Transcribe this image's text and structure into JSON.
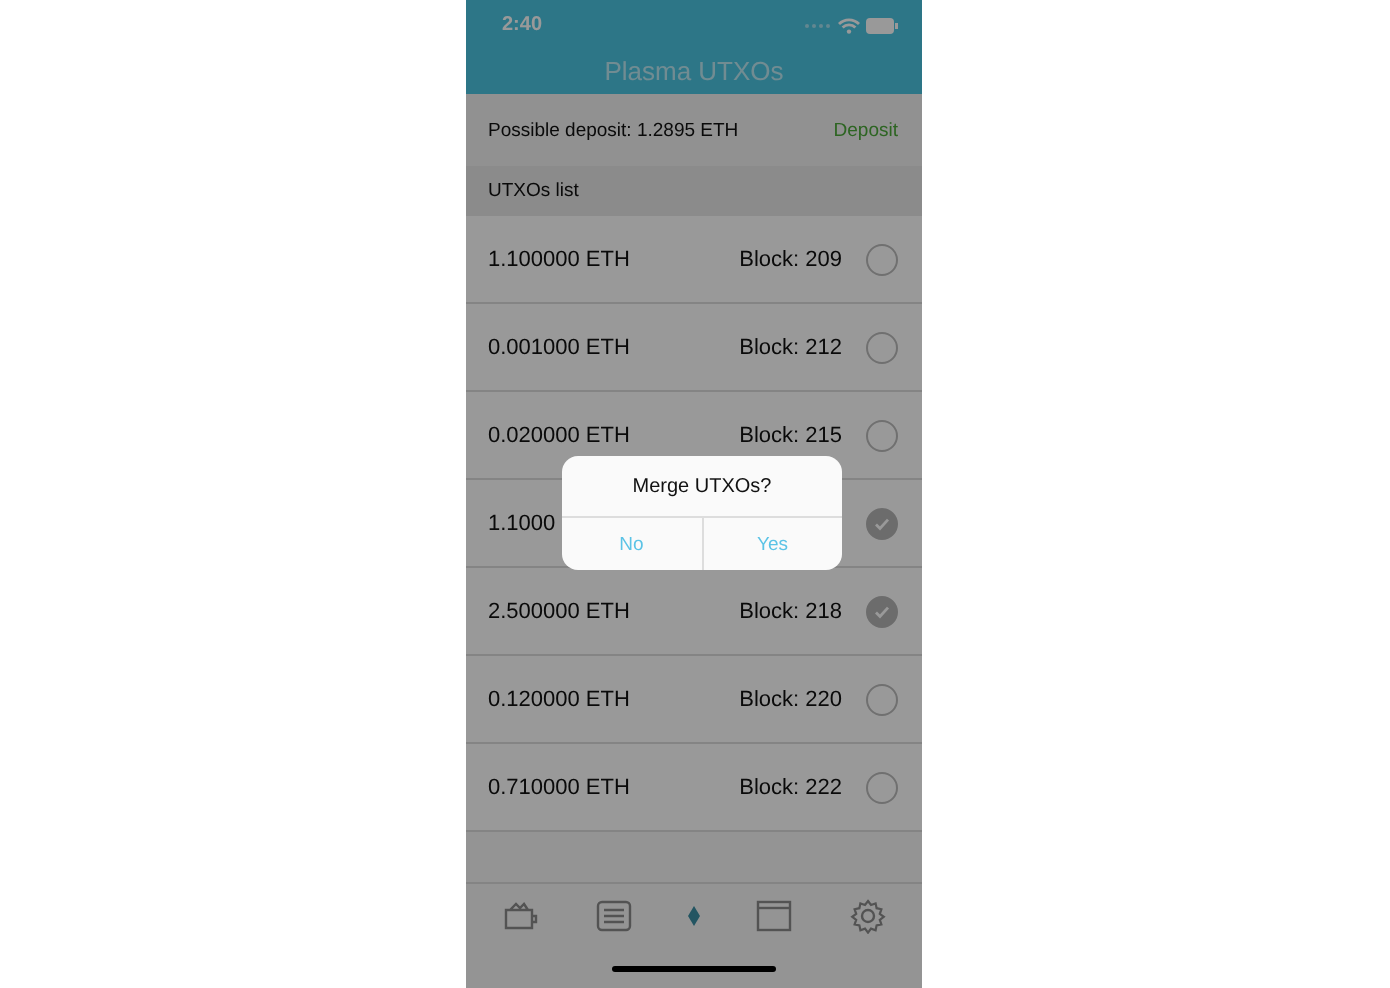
{
  "status_bar": {
    "time": "2:40"
  },
  "nav": {
    "title": "Plasma UTXOs"
  },
  "deposit": {
    "label": "Possible deposit: 1.2895 ETH",
    "action": "Deposit"
  },
  "section_header": "UTXOs list",
  "utxos": [
    {
      "amount": "1.100000 ETH",
      "block": "Block: 209",
      "checked": false
    },
    {
      "amount": "0.001000 ETH",
      "block": "Block: 212",
      "checked": false
    },
    {
      "amount": "0.020000 ETH",
      "block": "Block: 215",
      "checked": false
    },
    {
      "amount": "1.1000",
      "checked": true
    },
    {
      "amount": "2.500000 ETH",
      "block": "Block: 218",
      "checked": true
    },
    {
      "amount": "0.120000 ETH",
      "block": "Block: 220",
      "checked": false
    },
    {
      "amount": "0.710000 ETH",
      "block": "Block: 222",
      "checked": false
    }
  ],
  "tab_bar": [
    {
      "kind": "wallet",
      "selected": false
    },
    {
      "kind": "list",
      "selected": false
    },
    {
      "kind": "eth",
      "selected": true
    },
    {
      "kind": "window",
      "selected": false
    },
    {
      "kind": "settings",
      "selected": false
    }
  ],
  "alert": {
    "title": "Merge UTXOs?",
    "buttons": [
      "No",
      "Yes"
    ]
  }
}
